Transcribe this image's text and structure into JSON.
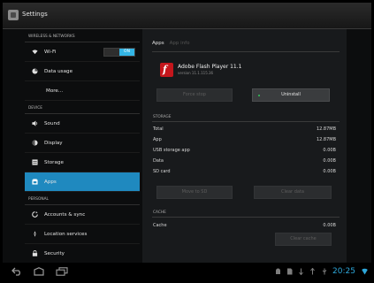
{
  "actionbar": {
    "title": "Settings"
  },
  "sidebar": {
    "section_wireless": "Wireless & networks",
    "wifi_label": "Wi-Fi",
    "wifi_toggle": "ON",
    "data_usage_label": "Data usage",
    "more_label": "More...",
    "section_device": "Device",
    "sound_label": "Sound",
    "display_label": "Display",
    "storage_label": "Storage",
    "apps_label": "Apps",
    "section_personal": "Personal",
    "accounts_label": "Accounts & sync",
    "location_label": "Location services",
    "security_label": "Security"
  },
  "detail": {
    "breadcrumb": "Apps",
    "breadcrumb_sub": "App info",
    "app_name": "Adobe Flash Player 11.1",
    "app_version": "version 11.1.115.36",
    "force_stop": "Force stop",
    "uninstall": "Uninstall",
    "storage_header": "Storage",
    "storage_rows": [
      {
        "label": "Total",
        "value": "12.87MB"
      },
      {
        "label": "App",
        "value": "12.87MB"
      },
      {
        "label": "USB storage app",
        "value": "0.00B"
      },
      {
        "label": "Data",
        "value": "0.00B"
      },
      {
        "label": "SD card",
        "value": "0.00B"
      }
    ],
    "move_btn": "Move to SD",
    "clear_data_btn": "Clear data",
    "cache_header": "Cache",
    "cache_label": "Cache",
    "cache_value": "0.00B",
    "clear_cache_btn": "Clear cache"
  },
  "navbar": {
    "clock": "20:25"
  },
  "colors": {
    "accent": "#33b5e5",
    "selected": "#1f89bf",
    "flash": "#c4161c"
  }
}
